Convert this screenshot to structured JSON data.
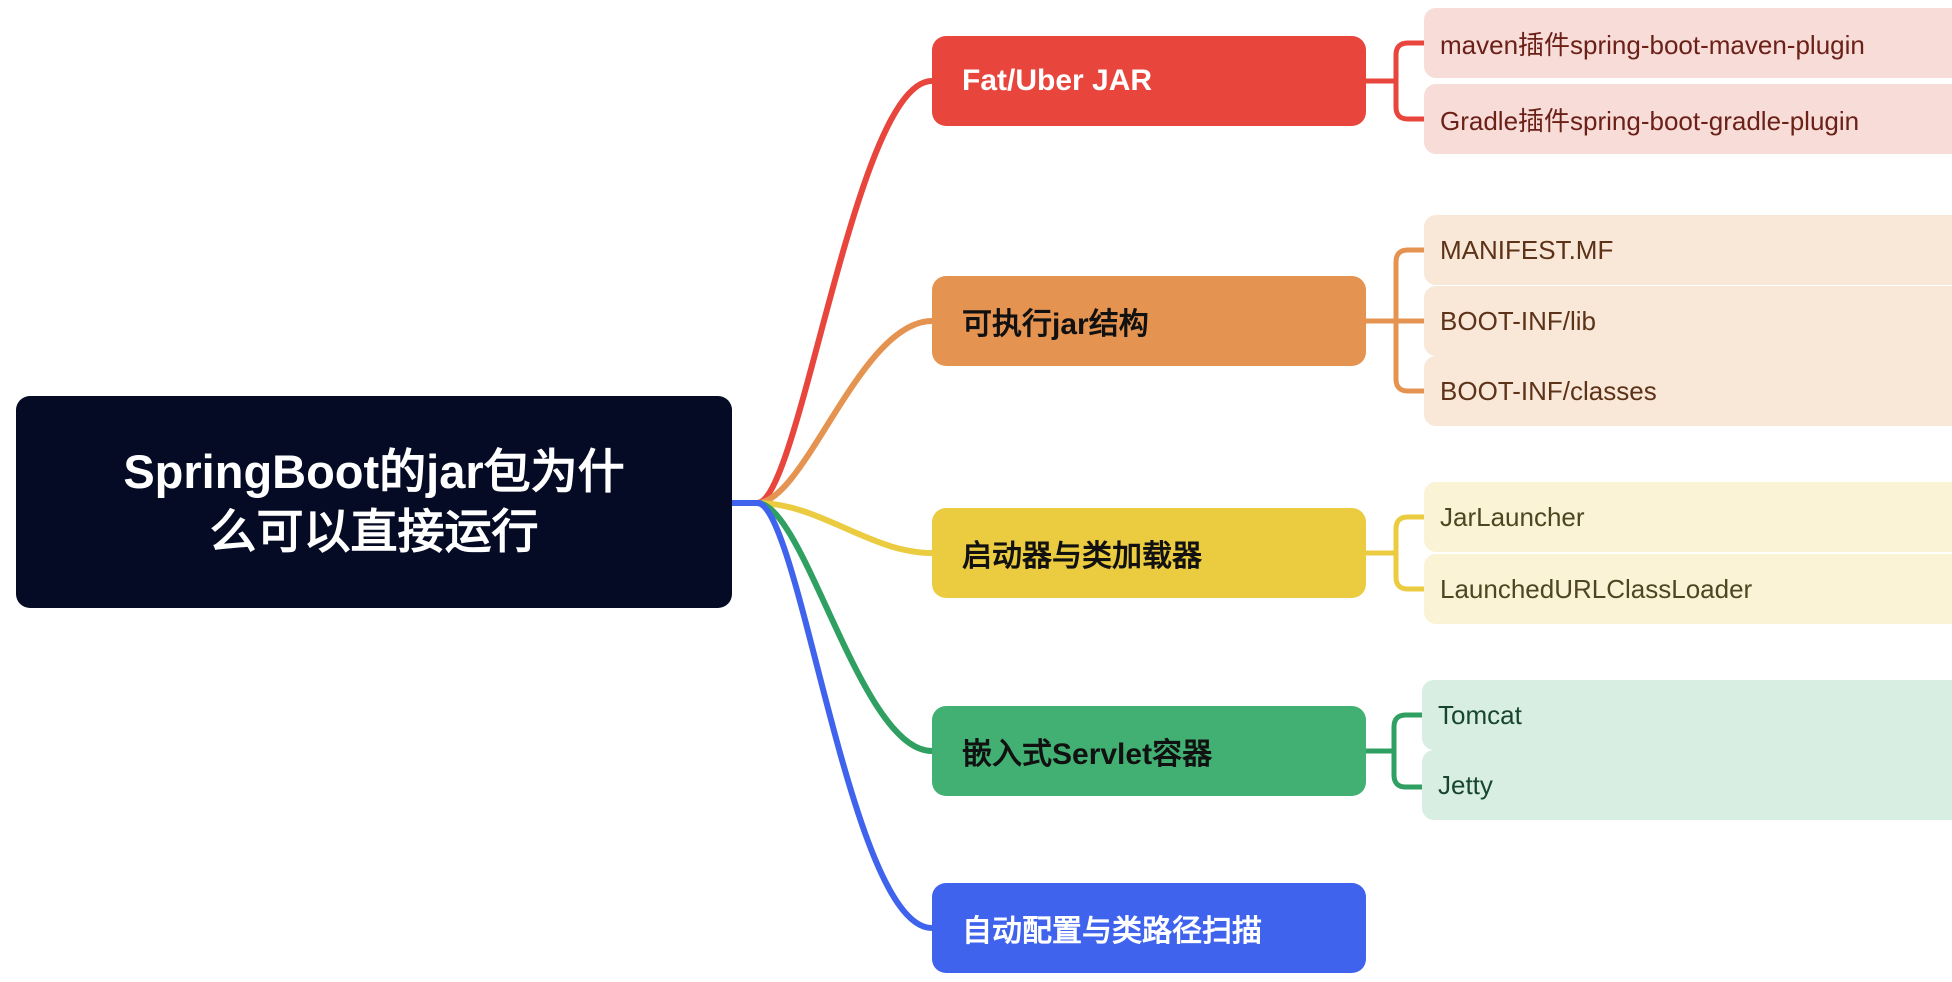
{
  "diagram": {
    "type": "mindmap",
    "title": "SpringBoot的jar包为什么可以直接运行",
    "background": "#ffffff",
    "root": {
      "label": "SpringBoot的jar包为什么可以直接运行",
      "line1": "SpringBoot的jar包为什",
      "line2": "么可以直接运行",
      "bg": "#050b24",
      "color": "#ffffff"
    },
    "branches": [
      {
        "label": "Fat/Uber JAR",
        "bg": "#e8453c",
        "color": "#ffffff",
        "link": "#e8453c",
        "leaf_bg": "#f7dcd8",
        "leaf_color": "#6b2018",
        "children": [
          {
            "label": "maven插件spring-boot-maven-plugin"
          },
          {
            "label": "Gradle插件spring-boot-gradle-plugin"
          }
        ]
      },
      {
        "label": "可执行jar结构",
        "bg": "#e59350",
        "color": "#111111",
        "link": "#e59350",
        "leaf_bg": "#f9e7d7",
        "leaf_color": "#5c3318",
        "children": [
          {
            "label": "MANIFEST.MF"
          },
          {
            "label": "BOOT-INF/lib"
          },
          {
            "label": "BOOT-INF/classes"
          }
        ]
      },
      {
        "label": "启动器与类加载器",
        "bg": "#ebcb40",
        "color": "#111111",
        "link": "#ebcb40",
        "leaf_bg": "#faf3d5",
        "leaf_color": "#4e4620",
        "children": [
          {
            "label": "JarLauncher"
          },
          {
            "label": "LaunchedURLClassLoader"
          }
        ]
      },
      {
        "label": "嵌入式Servlet容器",
        "bg": "#41b072",
        "color": "#111111",
        "link": "#2fa062",
        "leaf_bg": "#d8eee2",
        "leaf_color": "#17452f",
        "children": [
          {
            "label": "Tomcat"
          },
          {
            "label": "Jetty"
          }
        ]
      },
      {
        "label": "自动配置与类路径扫描",
        "bg": "#3f63ec",
        "color": "#ffffff",
        "link": "#3f63ec",
        "leaf_bg": "#dde4fb",
        "leaf_color": "#1b2b6b",
        "children": []
      }
    ]
  }
}
